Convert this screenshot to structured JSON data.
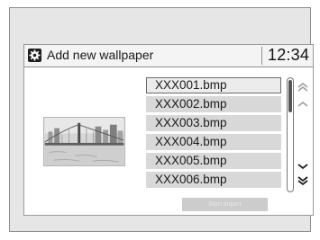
{
  "header": {
    "title": "Add new wallpaper",
    "clock": "12:34",
    "icon": "gear-icon"
  },
  "files": [
    {
      "name": "XXX001.bmp",
      "selected": true
    },
    {
      "name": "XXX002.bmp",
      "selected": false
    },
    {
      "name": "XXX003.bmp",
      "selected": false
    },
    {
      "name": "XXX004.bmp",
      "selected": false
    },
    {
      "name": "XXX005.bmp",
      "selected": false
    },
    {
      "name": "XXX006.bmp",
      "selected": false
    }
  ],
  "start_button": {
    "label": "Start import"
  },
  "scroll": {
    "icons": [
      "double-chevron-up-icon",
      "chevron-up-icon",
      "chevron-down-icon",
      "double-chevron-down-icon"
    ]
  },
  "preview": {
    "icon": "city-bridge-thumbnail"
  }
}
